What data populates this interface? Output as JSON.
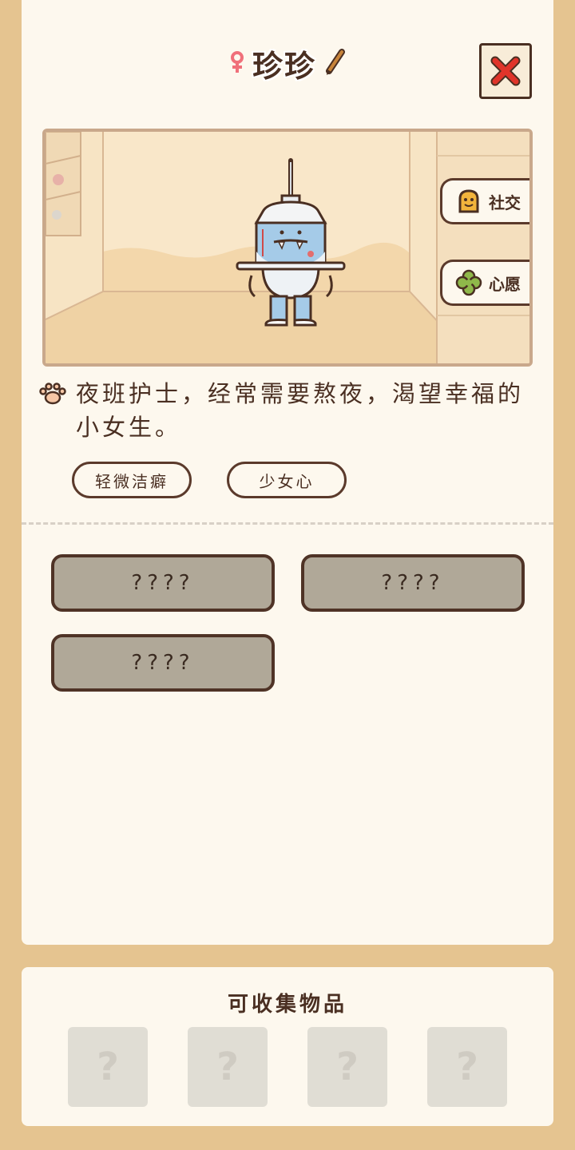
{
  "header": {
    "name": "珍珍"
  },
  "scene_buttons": {
    "social_label": "社交",
    "wish_label": "心愿"
  },
  "description": "夜班护士，经常需要熬夜，渴望幸福的小女生。",
  "tags": [
    "轻微洁癖",
    "少女心"
  ],
  "locked_traits": [
    "????",
    "????",
    "????"
  ],
  "collectibles": {
    "title": "可收集物品",
    "slots": [
      "?",
      "?",
      "?",
      "?"
    ]
  },
  "colors": {
    "background": "#e5c490",
    "card": "#fdf8ee",
    "text": "#4a2f22",
    "close_x": "#e0342a",
    "female_icon": "#f0707a",
    "locked_btn": "#b0a898"
  },
  "icons": {
    "gender": "female-icon",
    "edit": "pencil-icon",
    "close": "close-icon",
    "social": "social-icon",
    "wish": "clover-icon",
    "description": "paw-icon"
  }
}
